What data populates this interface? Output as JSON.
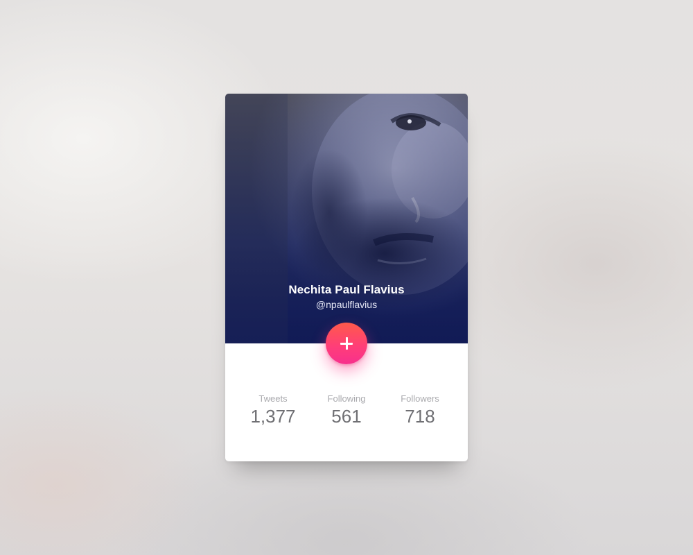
{
  "profile": {
    "name": "Nechita Paul Flavius",
    "handle": "@npaulflavius"
  },
  "follow_button": {
    "icon": "plus-icon"
  },
  "stats": [
    {
      "label": "Tweets",
      "value": "1,377"
    },
    {
      "label": "Following",
      "value": "561"
    },
    {
      "label": "Followers",
      "value": "718"
    }
  ],
  "colors": {
    "accent_top": "#ff5a4a",
    "accent_bottom": "#f7308d",
    "hero_overlay": "#17225e",
    "stat_label": "#a9a9ad",
    "stat_value": "#6f6f73"
  }
}
